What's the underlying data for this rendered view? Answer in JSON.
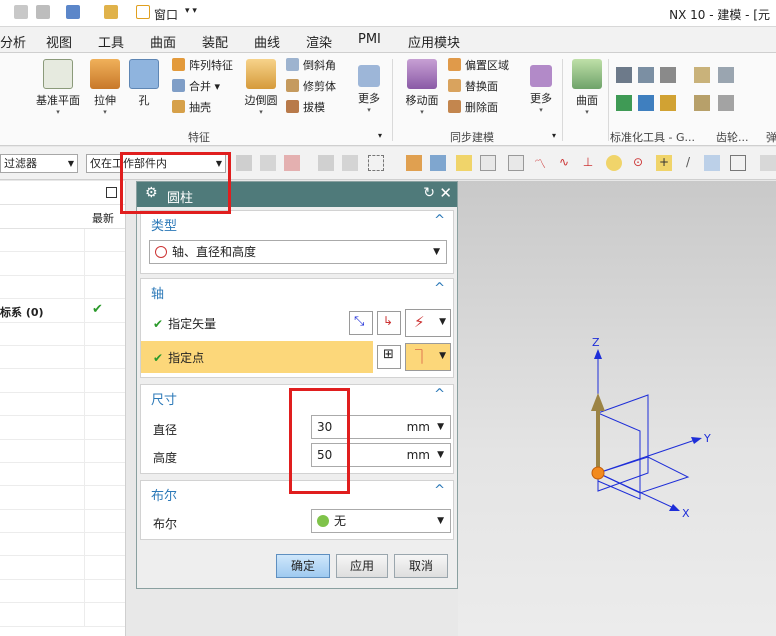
{
  "titlebar": {
    "window_menu": "窗口",
    "title": "NX 10 - 建模 - [元"
  },
  "menu": [
    "分析",
    "视图",
    "工具",
    "曲面",
    "装配",
    "曲线",
    "渲染",
    "PMI",
    "应用模块"
  ],
  "ribbon": {
    "feature": {
      "datum_plane": "基准平面",
      "extrude": "拉伸",
      "hole": "孔",
      "pattern_feature": "阵列特征",
      "unite": "合并",
      "shell": "抽壳",
      "edge_blend": "边倒圆",
      "chamfer": "倒斜角",
      "trim_body": "修剪体",
      "draft": "拔模",
      "more": "更多",
      "group_label": "特征"
    },
    "sync": {
      "move_face": "移动面",
      "offset_region": "偏置区域",
      "replace_face": "替换面",
      "delete_face": "删除面",
      "more": "更多",
      "group_label": "同步建模"
    },
    "surface": {
      "surface": "曲面"
    },
    "standard_tools_label": "标准化工具 - G...",
    "gear_label": "齿轮...",
    "spring_label": "弹"
  },
  "seltoolbar": {
    "filter": "过滤器",
    "scope": "仅在工作部件内"
  },
  "navigator": {
    "newest_col": "最新",
    "coord_row": "标系 (0)"
  },
  "dialog": {
    "title": "圆柱",
    "type_section": "类型",
    "type_value": "轴、直径和高度",
    "axis_section": "轴",
    "specify_vector": "指定矢量",
    "specify_point": "指定点",
    "dim_section": "尺寸",
    "diameter_label": "直径",
    "diameter_value": "30",
    "height_label": "高度",
    "height_value": "50",
    "unit": "mm",
    "boolean_section": "布尔",
    "boolean_label": "布尔",
    "boolean_value": "无",
    "ok": "确定",
    "apply": "应用",
    "cancel": "取消"
  },
  "viewport": {
    "axis_x": "X",
    "axis_y": "Y",
    "axis_z": "Z"
  }
}
